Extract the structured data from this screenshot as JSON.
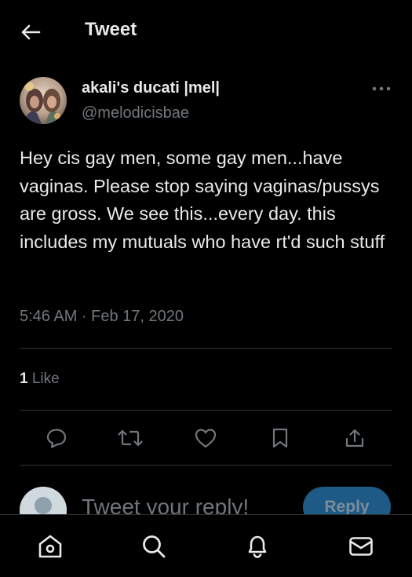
{
  "header": {
    "title": "Tweet",
    "back_icon": "arrow-left-icon"
  },
  "tweet": {
    "author_name": "akali's ducati |mel|",
    "author_handle": "@melodicisbae",
    "text": "Hey cis gay men, some gay men...have vaginas. Please stop saying vaginas/pussys are gross. We see this...every day. this includes my mutuals who have rt'd such stuff",
    "timestamp": "5:46 AM · Feb 17, 2020",
    "likes_count": "1",
    "likes_label": "Like"
  },
  "actions": [
    "reply-icon",
    "retweet-icon",
    "like-icon",
    "bookmark-icon",
    "share-icon"
  ],
  "reply": {
    "placeholder": "Tweet your reply!",
    "button_label": "Reply"
  },
  "bottom_nav": [
    "home-icon",
    "search-icon",
    "notifications-icon",
    "messages-icon"
  ],
  "colors": {
    "background": "#000000",
    "text": "#e7e9ea",
    "muted": "#71767b",
    "divider": "#2f3336",
    "reply_button": "#1d5a86"
  }
}
